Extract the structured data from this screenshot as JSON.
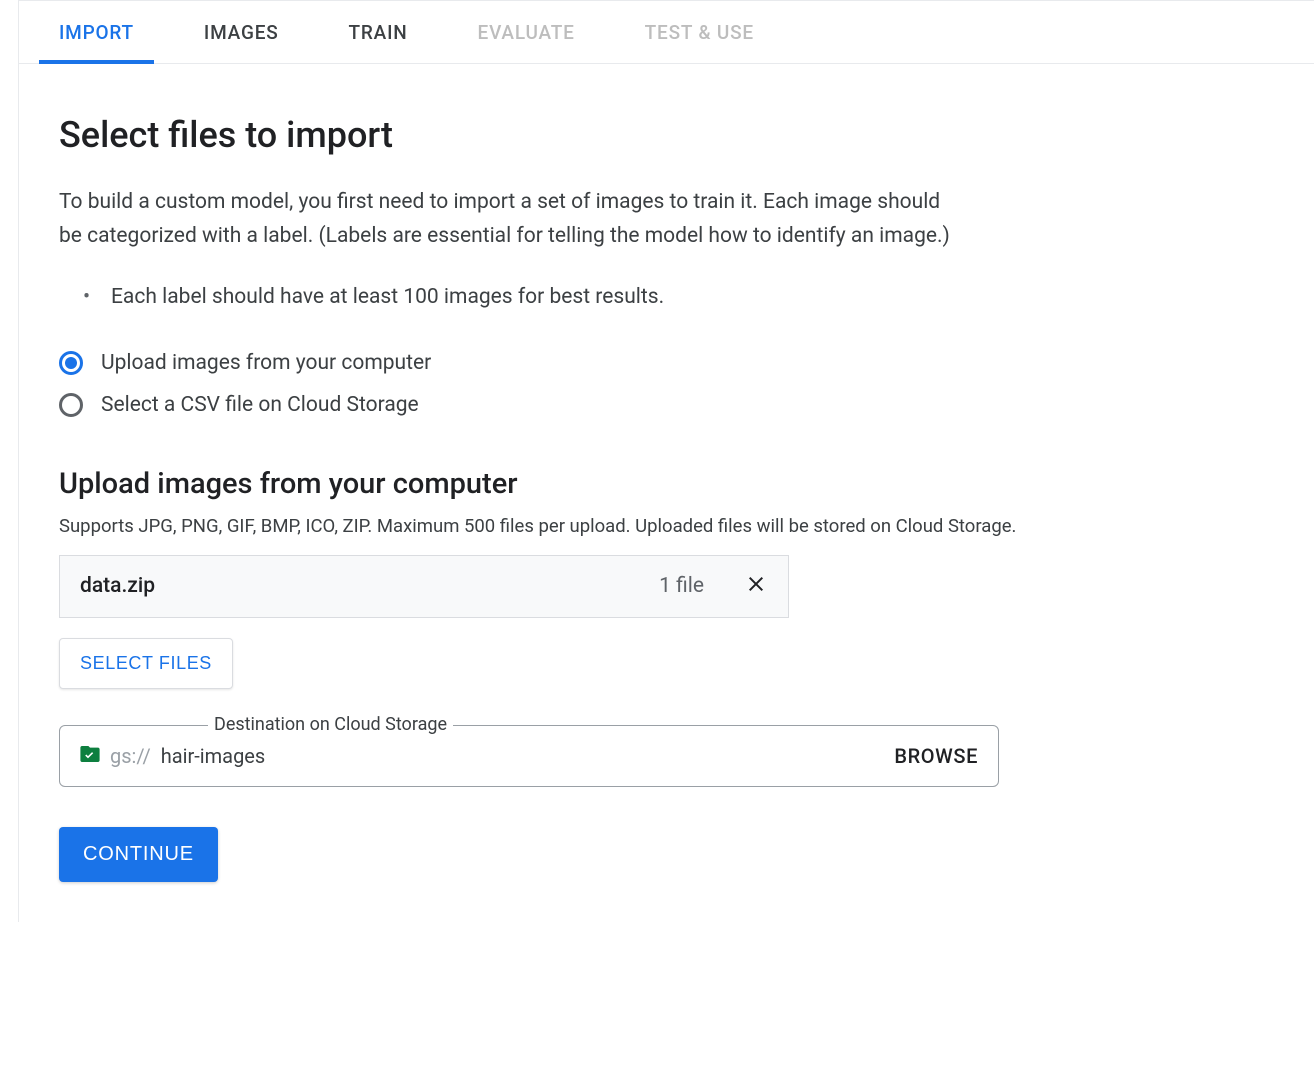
{
  "tabs": [
    {
      "label": "IMPORT",
      "state": "active"
    },
    {
      "label": "IMAGES",
      "state": "normal"
    },
    {
      "label": "TRAIN",
      "state": "normal"
    },
    {
      "label": "EVALUATE",
      "state": "disabled"
    },
    {
      "label": "TEST & USE",
      "state": "disabled"
    }
  ],
  "heading": "Select files to import",
  "description": "To build a custom model, you first need to import a set of images to train it. Each image should be categorized with a label. (Labels are essential for telling the model how to identify an image.)",
  "bullets": [
    "Each label should have at least 100 images for best results."
  ],
  "radio_options": [
    {
      "label": "Upload images from your computer",
      "selected": true
    },
    {
      "label": "Select a CSV file on Cloud Storage",
      "selected": false
    }
  ],
  "upload_section": {
    "title": "Upload images from your computer",
    "supports": "Supports JPG, PNG, GIF, BMP, ICO, ZIP. Maximum 500 files per upload. Uploaded files will be stored on Cloud Storage.",
    "file": {
      "name": "data.zip",
      "count_label": "1 file"
    },
    "select_files_label": "SELECT FILES",
    "destination": {
      "legend": "Destination on Cloud Storage",
      "prefix": "gs://",
      "value": "hair-images",
      "browse_label": "BROWSE"
    }
  },
  "continue_label": "CONTINUE"
}
